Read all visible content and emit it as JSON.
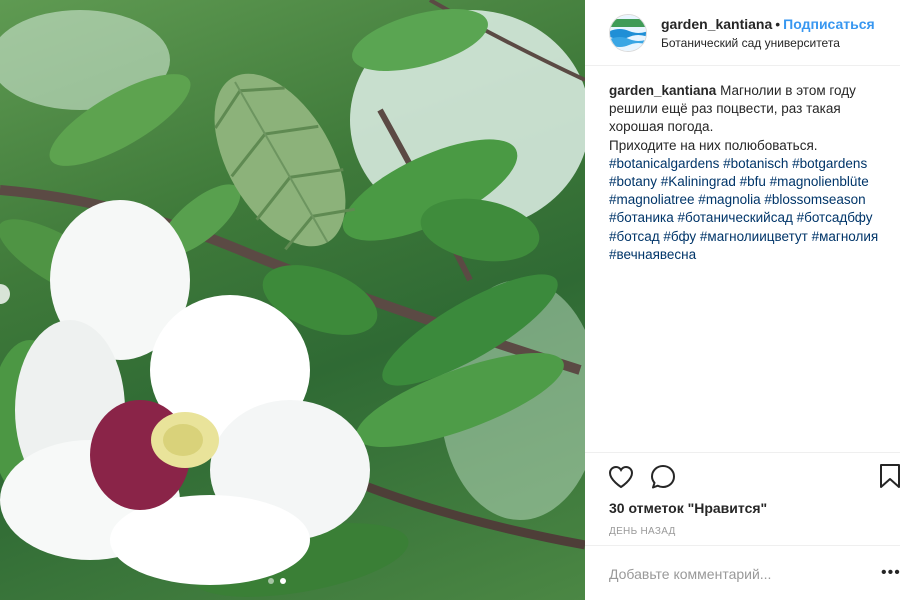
{
  "post": {
    "username": "garden_kantiana",
    "separator": "•",
    "follow_label": "Подписаться",
    "location": "Ботанический сад университета",
    "avatar_icon": "garden-logo-icon"
  },
  "caption": {
    "username": "garden_kantiana",
    "text_line1": "Магнолии в этом году решили ещё раз поцвести, раз такая хорошая погода.",
    "text_line2": "Приходите на них полюбоваться.",
    "hashtags": "#botanicalgardens #botanisch #botgardens #botany #Kaliningrad #bfu #magnolienblüte #magnoliatree #magnolia #blossomseason #ботаника #ботаническийсад #ботсадбфу #ботсад #бфу #магнолиицветут #магнолия #вечнаявесна"
  },
  "actions": {
    "like_icon": "heart-icon",
    "comment_icon": "comment-icon",
    "save_icon": "bookmark-icon",
    "likes_text": "30 отметок \"Нравится\"",
    "timestamp": "ДЕНЬ НАЗАД"
  },
  "comment": {
    "placeholder": "Добавьте комментарий...",
    "more_label": "•••"
  },
  "carousel": {
    "image_count": 2,
    "active_index": 1
  },
  "colors": {
    "link": "#3897f0",
    "hashtag": "#003569",
    "text": "#262626",
    "muted": "#999999"
  }
}
